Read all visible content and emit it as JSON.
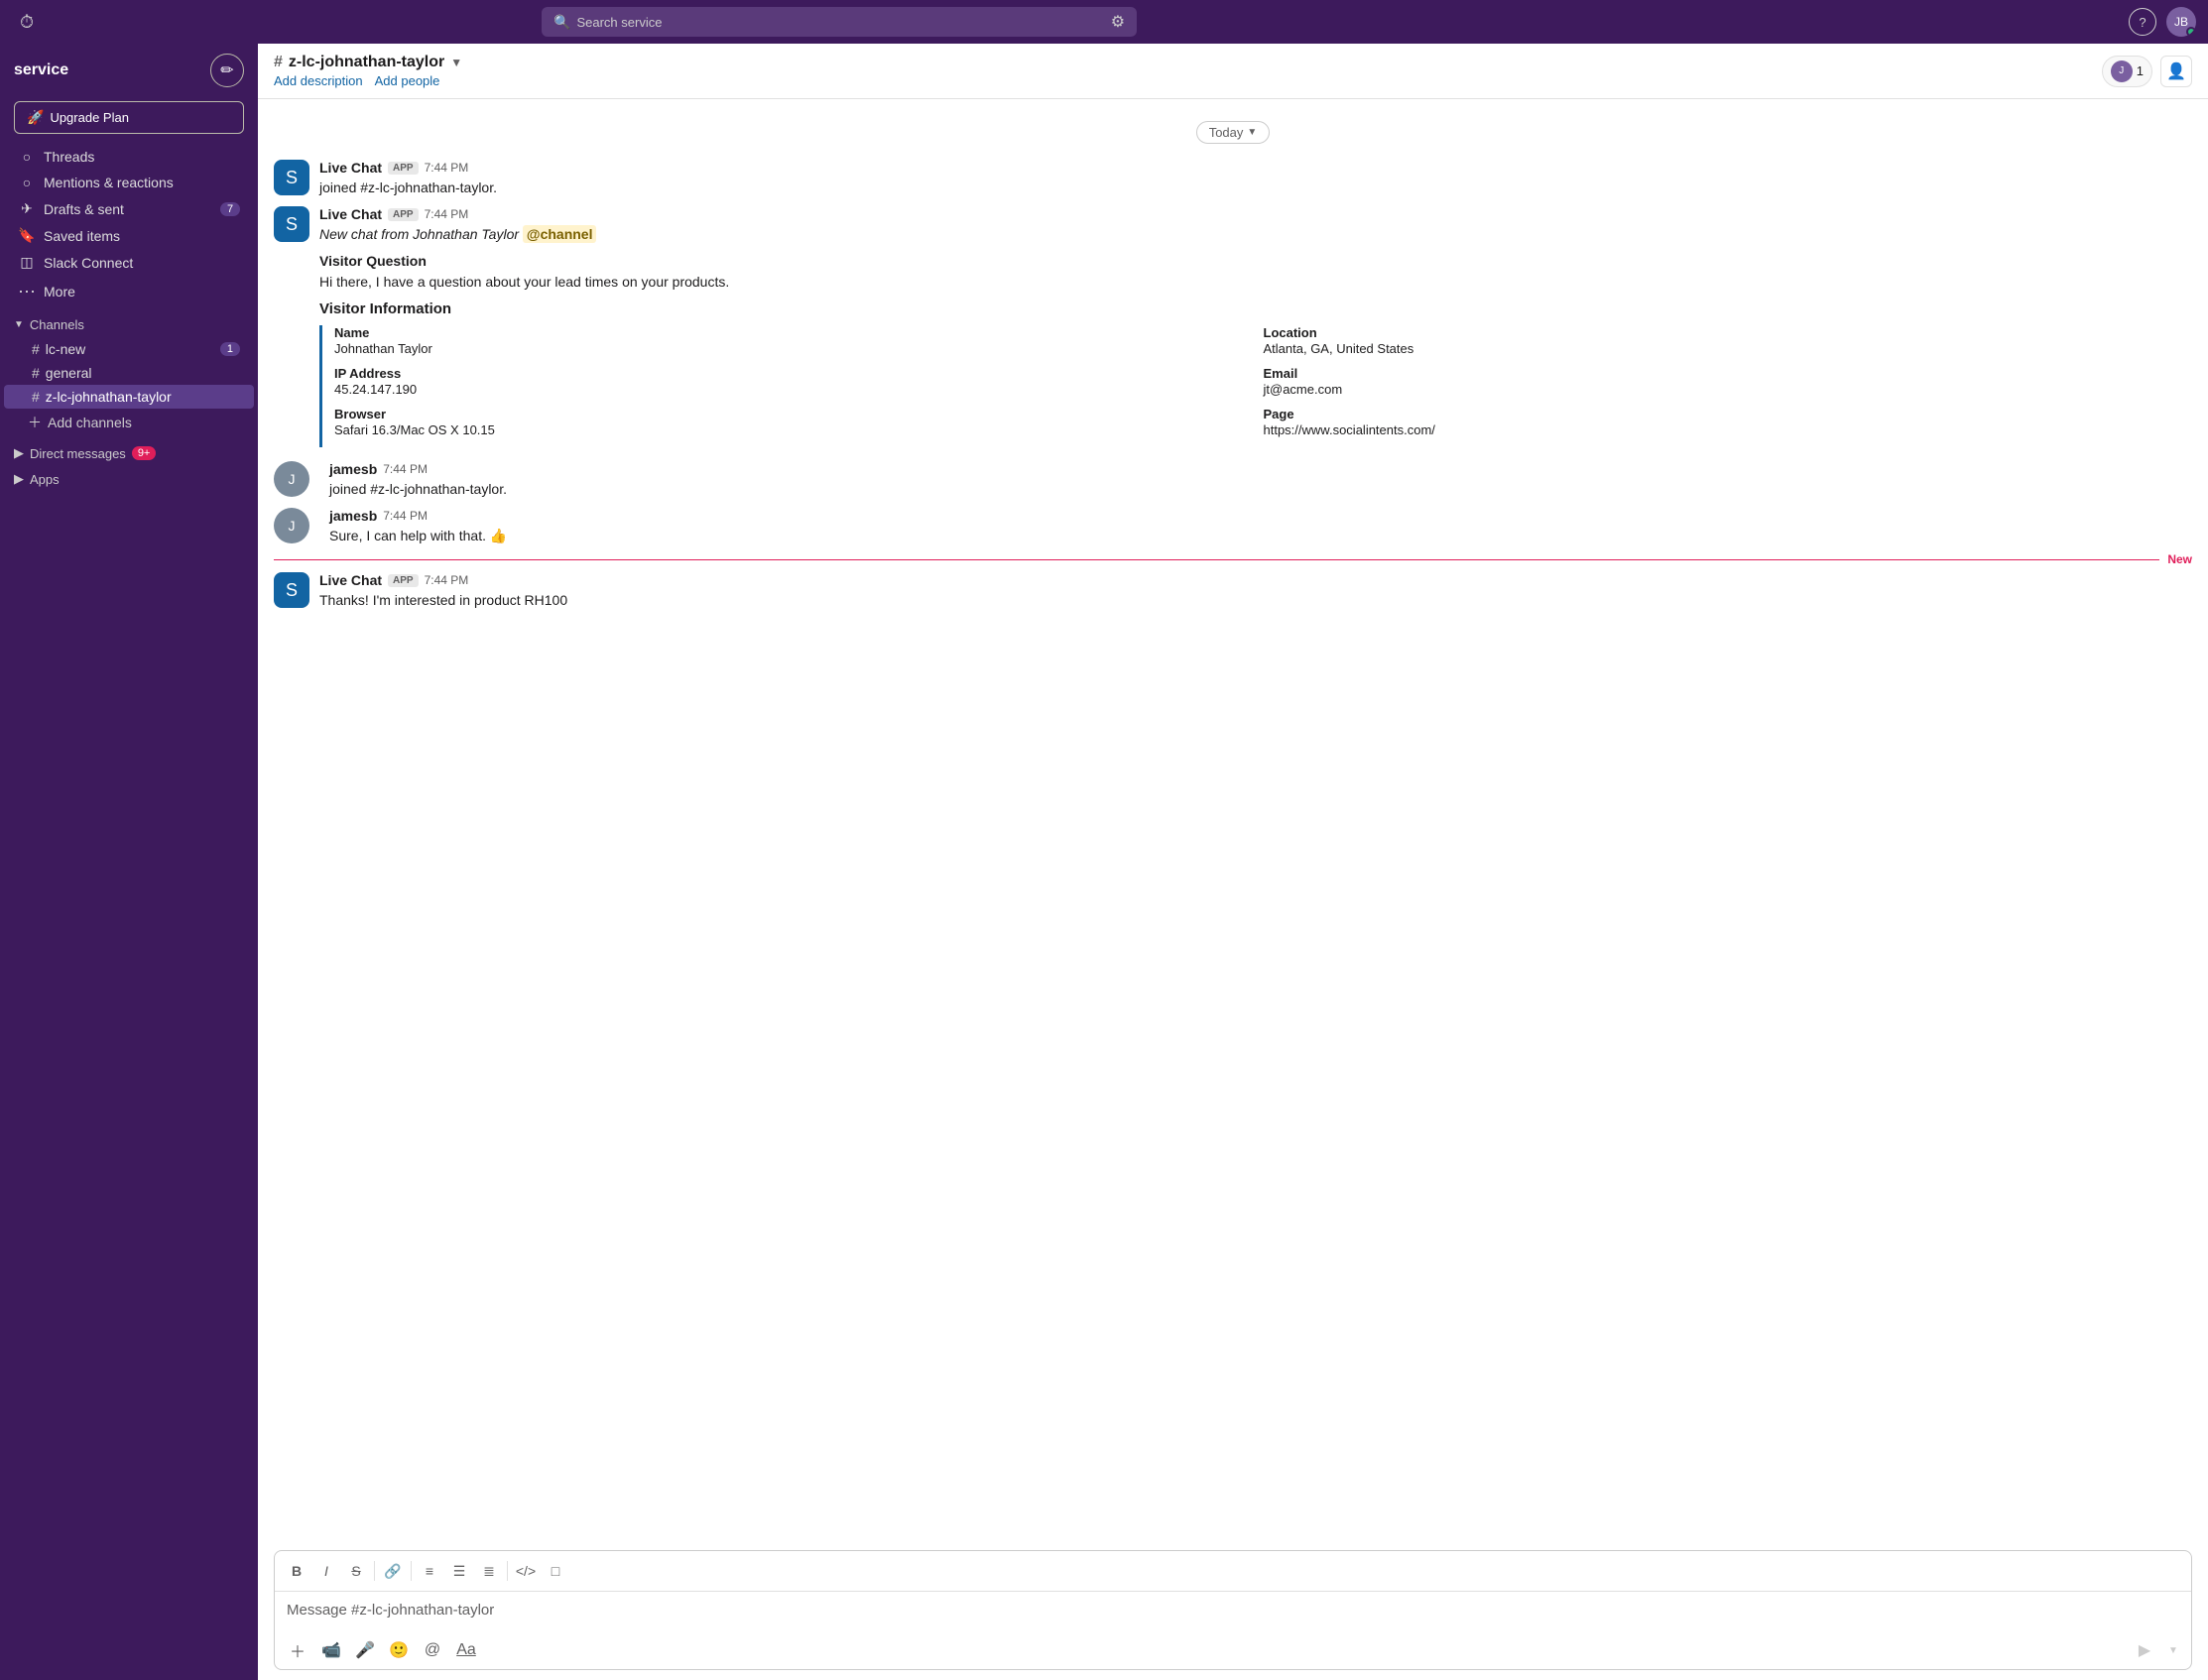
{
  "topbar": {
    "search_placeholder": "Search service",
    "history_icon": "⏱",
    "filter_icon": "⚙",
    "help_label": "?",
    "avatar_initials": "JB"
  },
  "sidebar": {
    "workspace": "service",
    "upgrade_label": "Upgrade Plan",
    "nav_items": [
      {
        "id": "threads",
        "icon": "○",
        "label": "Threads"
      },
      {
        "id": "mentions",
        "icon": "○",
        "label": "Mentions & reactions"
      },
      {
        "id": "drafts",
        "icon": "✈",
        "label": "Drafts & sent",
        "badge": "7"
      },
      {
        "id": "saved",
        "icon": "🔖",
        "label": "Saved items"
      },
      {
        "id": "connect",
        "icon": "◫",
        "label": "Slack Connect"
      },
      {
        "id": "more",
        "icon": "···",
        "label": "More"
      }
    ],
    "channels_label": "Channels",
    "channels": [
      {
        "id": "lc-new",
        "name": "lc-new",
        "badge": "1"
      },
      {
        "id": "general",
        "name": "general",
        "badge": ""
      },
      {
        "id": "z-lc-johnathan-taylor",
        "name": "z-lc-johnathan-taylor",
        "badge": "",
        "active": true
      }
    ],
    "add_channels_label": "Add channels",
    "direct_messages_label": "Direct messages",
    "direct_messages_badge": "9+",
    "apps_label": "Apps"
  },
  "channel": {
    "hash": "#",
    "name": "z-lc-johnathan-taylor",
    "add_description": "Add description",
    "add_people": "Add people",
    "member_count": "1"
  },
  "date_label": "Today",
  "messages": [
    {
      "id": "msg1",
      "author": "Live Chat",
      "app_badge": "APP",
      "time": "7:44 PM",
      "text": "joined #z-lc-johnathan-taylor.",
      "avatar_type": "live_chat"
    },
    {
      "id": "msg2",
      "author": "Live Chat",
      "app_badge": "APP",
      "time": "7:44 PM",
      "text_parts": {
        "prefix": "New chat from Johnathan Taylor",
        "mention": "@channel"
      },
      "visitor_question": "Visitor Question",
      "visitor_question_text": "Hi there, I have a question about your lead times on your products.",
      "visitor_info": {
        "title": "Visitor Information",
        "fields": [
          {
            "label": "Name",
            "value": "Johnathan Taylor",
            "col": 1
          },
          {
            "label": "Location",
            "value": "Atlanta, GA, United States",
            "col": 2
          },
          {
            "label": "IP Address",
            "value": "45.24.147.190",
            "col": 1
          },
          {
            "label": "Email",
            "value": "jt@acme.com",
            "col": 2
          },
          {
            "label": "Browser",
            "value": "Safari 16.3/Mac OS X 10.15",
            "col": 1
          },
          {
            "label": "Page",
            "value": "https://www.socialintents.com/",
            "col": 1
          }
        ]
      },
      "avatar_type": "live_chat"
    },
    {
      "id": "msg3",
      "author": "jamesb",
      "time": "7:44 PM",
      "text": "joined #z-lc-johnathan-taylor.",
      "avatar_type": "user"
    },
    {
      "id": "msg4",
      "author": "jamesb",
      "time": "7:44 PM",
      "text": "Sure, I can help with that. 👍",
      "avatar_type": "user"
    },
    {
      "id": "msg5",
      "author": "Live Chat",
      "app_badge": "APP",
      "time": "7:44 PM",
      "text": "Thanks!  I'm interested in product RH100",
      "avatar_type": "live_chat"
    }
  ],
  "new_label": "New",
  "input": {
    "placeholder": "Message #z-lc-johnathan-taylor",
    "toolbar_buttons": [
      "B",
      "I",
      "S",
      "🔗",
      "≡",
      "☰",
      "≣",
      "</>",
      "□"
    ]
  }
}
